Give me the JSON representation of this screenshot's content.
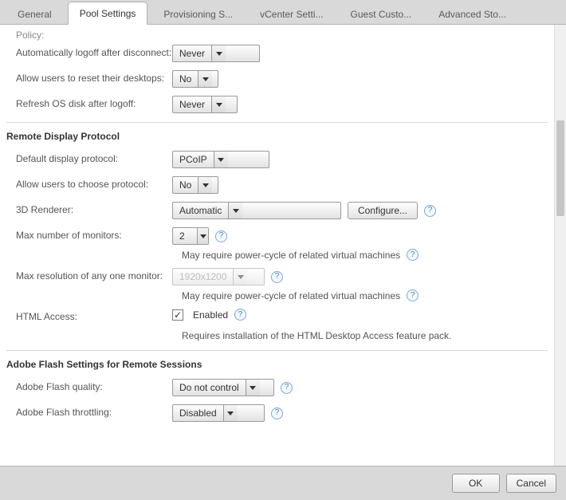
{
  "tabs": {
    "general": "General",
    "pool_settings": "Pool Settings",
    "provisioning": "Provisioning S...",
    "vcenter": "vCenter Setti...",
    "guest": "Guest Custo...",
    "advanced": "Advanced Sto..."
  },
  "truncated_policy": "Policy:",
  "labels": {
    "auto_logoff": "Automatically logoff after disconnect:",
    "allow_reset": "Allow users to reset their desktops:",
    "refresh_os": "Refresh OS disk after logoff:",
    "default_protocol": "Default display protocol:",
    "allow_choose_protocol": "Allow users to choose protocol:",
    "renderer3d": "3D Renderer:",
    "max_monitors": "Max number of monitors:",
    "max_resolution": "Max resolution of any one monitor:",
    "html_access": "HTML Access:",
    "flash_quality": "Adobe Flash quality:",
    "flash_throttling": "Adobe Flash throttling:"
  },
  "sections": {
    "remote_display": "Remote Display Protocol",
    "flash": "Adobe Flash Settings for Remote Sessions"
  },
  "values": {
    "auto_logoff": "Never",
    "allow_reset": "No",
    "refresh_os": "Never",
    "default_protocol": "PCoIP",
    "allow_choose_protocol": "No",
    "renderer3d": "Automatic",
    "max_monitors": "2",
    "max_resolution": "1920x1200",
    "html_enabled_label": "Enabled",
    "flash_quality": "Do not control",
    "flash_throttling": "Disabled"
  },
  "buttons": {
    "configure": "Configure...",
    "ok": "OK",
    "cancel": "Cancel"
  },
  "hints": {
    "power_cycle": "May require power-cycle of related virtual machines",
    "html_requires": "Requires installation of the HTML Desktop Access feature pack."
  }
}
